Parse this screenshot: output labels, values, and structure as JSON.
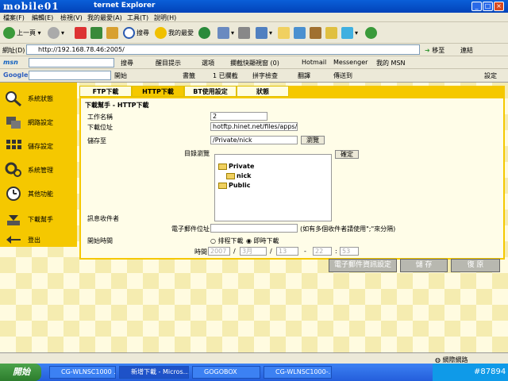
{
  "window": {
    "title": "ternet Explorer",
    "logo": "mobile01"
  },
  "menu": [
    "檔案(F)",
    "編輯(E)",
    "檢視(V)",
    "我的最愛(A)",
    "工具(T)",
    "說明(H)"
  ],
  "toolbar": {
    "back": "上一頁",
    "search": "搜尋",
    "favorites": "我的最愛"
  },
  "address": {
    "label": "網址(D)",
    "value": "http://192.168.78.46:2005/",
    "go": "移至",
    "links": "連結"
  },
  "msn": {
    "search": "搜尋",
    "highlight": "醒目提示",
    "options": "選項",
    "popup": "攔截快顯視窗 (0)",
    "hotmail": "Hotmail",
    "messenger": "Messenger",
    "mymsn": "我的 MSN"
  },
  "google": {
    "logo": "Google",
    "start": "開始",
    "bookmarks": "書籤",
    "blocked": "1 已攔截",
    "spellcheck": "拼字檢查",
    "translate": "翻譯",
    "sendto": "傳送到",
    "settings": "設定"
  },
  "sidebar": [
    {
      "label": "系統狀態",
      "icon": "magnifier-icon"
    },
    {
      "label": "網路設定",
      "icon": "network-icon"
    },
    {
      "label": "儲存設定",
      "icon": "storage-icon"
    },
    {
      "label": "系統管理",
      "icon": "gears-icon"
    },
    {
      "label": "其他功能",
      "icon": "clock-icon"
    },
    {
      "label": "下載幫手",
      "icon": "download-icon"
    },
    {
      "label": "登出",
      "icon": "logout-icon"
    }
  ],
  "tabs": [
    "FTP下載",
    "HTTP下載",
    "BT使用設定",
    "狀態"
  ],
  "form": {
    "section": "下載幫手 - HTTP下載",
    "job_label": "工作名稱",
    "job_value": "2",
    "url_label": "下載位址",
    "url_value": "hotftp.hinet.net/files/apps/02z",
    "save_label": "儲存至",
    "save_value": "/Private/nick",
    "browse": "瀏覽",
    "tree_label": "目錄瀏覽",
    "ok": "確定",
    "tree": {
      "private": "Private",
      "nick": "nick",
      "public": "Public"
    },
    "notify_label": "訊息收件者",
    "email_label": "電子郵件位址",
    "email_value": "",
    "email_hint": "(如有多個收件者請使用\";\"來分隔)",
    "start_label": "開始時間",
    "schedule": "排程下載",
    "immediate": "即時下載",
    "time_label": "時間",
    "year": "2007",
    "month": "3月",
    "day": "13",
    "hour": "22",
    "minute": "53",
    "sep_slash": "/",
    "sep_dash": "-",
    "sep_colon": ":"
  },
  "buttons": {
    "email_settings": "電子郵件資訊設定",
    "save": "儲 存",
    "restore": "復 原"
  },
  "status": {
    "zone": "網際網路"
  },
  "taskbar": {
    "start": "開始",
    "items": [
      "CG-WLNSC1000 ...",
      "新增下載 - Micros...",
      "GOGOBOX",
      "CG-WLNSC1000-..."
    ],
    "tray": "#87894"
  }
}
